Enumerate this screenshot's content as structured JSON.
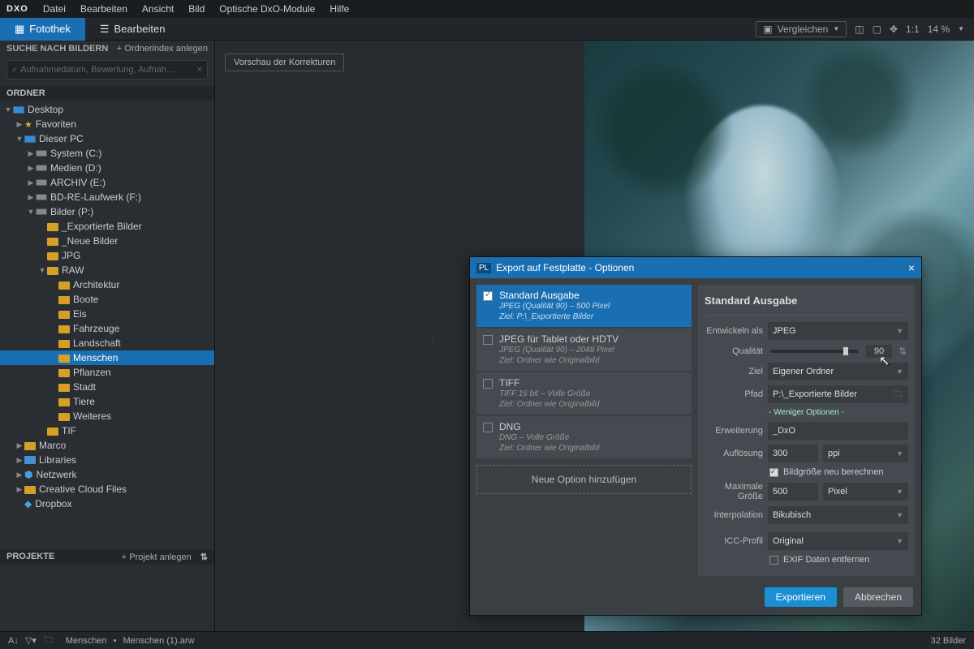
{
  "menubar": {
    "logo": "DXO",
    "items": [
      "Datei",
      "Bearbeiten",
      "Ansicht",
      "Bild",
      "Optische DxO-Module",
      "Hilfe"
    ]
  },
  "toolbar": {
    "fotothek": "Fotothek",
    "bearbeiten": "Bearbeiten",
    "compare": "Vergleichen",
    "ratio": "1:1",
    "zoom": "14 %"
  },
  "search": {
    "title": "SUCHE NACH BILDERN",
    "addIndex": "+ Ordnerindex anlegen",
    "placeholder": "Aufnahmedatum, Bewertung, Aufnah…"
  },
  "sections": {
    "ordner": "ORDNER",
    "projekte": "PROJEKTE",
    "addProj": "+ Projekt anlegen"
  },
  "tree": {
    "desktop": "Desktop",
    "fav": "Favoriten",
    "pc": "Dieser PC",
    "sysC": "System (C:)",
    "medD": "Medien (D:)",
    "arcE": "ARCHIV (E:)",
    "bdF": "BD-RE-Laufwerk (F:)",
    "bildP": "Bilder (P:)",
    "exp": "_Exportierte Bilder",
    "neu": "_Neue Bilder",
    "jpg": "JPG",
    "raw": "RAW",
    "arch": "Architektur",
    "boote": "Boote",
    "eis": "Eis",
    "fahr": "Fahrzeuge",
    "land": "Landschaft",
    "mensch": "Menschen",
    "pflanz": "Pflanzen",
    "stadt": "Stadt",
    "tiere": "Tiere",
    "weit": "Weiteres",
    "tif": "TIF",
    "marco": "Marco",
    "libs": "Libraries",
    "netz": "Netzwerk",
    "ccf": "Creative Cloud Files",
    "dbx": "Dropbox"
  },
  "preview": {
    "badge": "Vorschau der Korrekturen"
  },
  "dialog": {
    "title": "Export auf Festplatte - Optionen",
    "presets": [
      {
        "name": "Standard Ausgabe",
        "d1": "JPEG (Qualität 90)  –  500 Pixel",
        "d2": "Ziel: P:\\_Exportierte Bilder"
      },
      {
        "name": "JPEG für Tablet oder HDTV",
        "d1": "JPEG (Qualität 90)  –  2048 Pixel",
        "d2": "Ziel: Ordner wie Originalbild"
      },
      {
        "name": "TIFF",
        "d1": "TIFF 16 bit  –  Volle Größe",
        "d2": "Ziel: Ordner wie Originalbild"
      },
      {
        "name": "DNG",
        "d1": "DNG  –  Volle Größe",
        "d2": "Ziel: Ordner wie Originalbild"
      }
    ],
    "addOption": "Neue Option hinzufügen",
    "panelTitle": "Standard Ausgabe",
    "labels": {
      "entwickeln": "Entwickeln als",
      "qual": "Qualität",
      "ziel": "Ziel",
      "pfad": "Pfad",
      "fewer": "- Weniger Optionen -",
      "erw": "Erweiterung",
      "aufl": "Auflösung",
      "recalc": "Bildgröße neu berechnen",
      "maxg": "Maximale Größe",
      "interp": "Interpolation",
      "icc": "ICC-Profil",
      "exif": "EXIF Daten entfernen"
    },
    "values": {
      "format": "JPEG",
      "qual": "90",
      "ziel": "Eigener Ordner",
      "pfad": "P:\\_Exportierte Bilder",
      "erw": "_DxO",
      "aufl": "300",
      "auflUnit": "ppi",
      "maxg": "500",
      "maxgUnit": "Pixel",
      "interp": "Bikubisch",
      "icc": "Original"
    },
    "buttons": {
      "export": "Exportieren",
      "cancel": "Abbrechen"
    }
  },
  "status": {
    "path1": "Menschen",
    "path2": "Menschen (1).arw",
    "count": "32 Bilder"
  }
}
